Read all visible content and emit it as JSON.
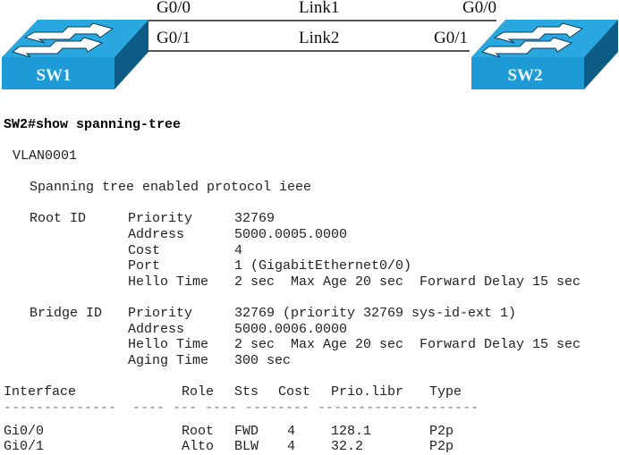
{
  "topology": {
    "switches": [
      {
        "name": "SW1",
        "color_top": "#29a8e0",
        "color_front": "#1e9bd6",
        "color_side": "#0c5c86"
      },
      {
        "name": "SW2",
        "color_top": "#29a8e0",
        "color_front": "#1e9bd6",
        "color_side": "#0c5c86"
      }
    ],
    "links": [
      {
        "name": "Link1",
        "sw1_port": "G0/0",
        "sw2_port": "G0/0"
      },
      {
        "name": "Link2",
        "sw1_port": "G0/1",
        "sw2_port": "G0/1"
      }
    ]
  },
  "cli": {
    "command": "SW2#show spanning-tree",
    "vlan": "VLAN0001",
    "protocol_line": "Spanning tree enabled protocol ieee",
    "root_id": {
      "label": "Root ID",
      "rows": [
        {
          "key": "Priority",
          "value": "32769"
        },
        {
          "key": "Address",
          "value": "5000.0005.0000"
        },
        {
          "key": "Cost",
          "value": "4"
        },
        {
          "key": "Port",
          "value": "1 (GigabitEthernet0/0)"
        },
        {
          "key": "Hello Time",
          "value": "2 sec  Max Age 20 sec  Forward Delay 15 sec"
        }
      ]
    },
    "bridge_id": {
      "label": "Bridge ID",
      "rows": [
        {
          "key": "Priority",
          "value": "32769 (priority 32769 sys-id-ext 1)"
        },
        {
          "key": "Address",
          "value": "5000.0006.0000"
        },
        {
          "key": "Hello Time",
          "value": "2 sec  Max Age 20 sec  Forward Delay 15 sec"
        },
        {
          "key": "Aging Time",
          "value": "300 sec"
        }
      ]
    },
    "table": {
      "headers": [
        "Interface",
        "Role",
        "Sts",
        "Cost",
        "Prio.libr",
        "Type"
      ],
      "separator": "--------------  ---- --- ---- -------- --------------------",
      "rows": [
        [
          "Gi0/0",
          "Root",
          "FWD",
          "4",
          "128.1",
          "P2p"
        ],
        [
          "Gi0/1",
          "Alto",
          "BLW",
          "4",
          "32.2",
          "P2p"
        ]
      ]
    }
  }
}
